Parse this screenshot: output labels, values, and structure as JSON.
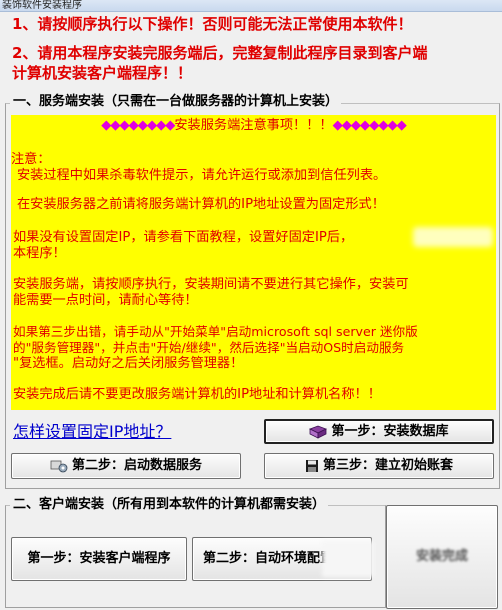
{
  "window": {
    "title": "装饰软件安装程序"
  },
  "warnings": {
    "line1": "1、请按顺序执行以下操作！否则可能无法正常使用本软件！",
    "line2a": "2、请用本程序安装完服务端后，完整复制此程序目录到客户端",
    "line2b": "计算机安装客户端程序！！"
  },
  "server_group": {
    "legend": "一、服务端安装（只需在一台做服务器的计算机上安装）",
    "notice": {
      "heading_diamonds_left": "◆◆◆◆◆◆◆◆",
      "heading_text": "安装服务端注意事项！！！",
      "heading_diamonds_right": "◆◆◆◆◆◆◆◆",
      "label": "注意：",
      "p1": "安装过程中如果杀毒软件提示，请允许运行或添加到信任列表。",
      "p2": "在安装服务器之前请将服务端计算机的IP地址设置为固定形式！",
      "p3a": "如果没有设置固定IP，请参看下面教程，设置好固定IP后，",
      "p3b": "本程序！",
      "p4a": "安装服务端，请按顺序执行，安装期间请不要进行其它操作，安装可",
      "p4b": "能需要一点时间，请耐心等待！",
      "p5a": "如果第三步出错，请手动从\"开始菜单\"启动microsoft sql server 迷你版",
      "p5b": "的\"服务管理器\"，并点击\"开始/继续\"，然后选择\"当启动OS时启动服务",
      "p5c": "\"复选框。启动好之后关闭服务管理器！",
      "p6": "安装完成后请不要更改服务端计算机的IP地址和计算机名称！！"
    },
    "help_link": "怎样设置固定IP地址？",
    "step1_label": "第一步：安装数据库",
    "step2_label": "第二步：启动数据服务",
    "step3_label": "第三步：建立初始账套"
  },
  "client_group": {
    "legend": "二、客户端安装（所有用到本软件的计算机都需安装）",
    "step1_label": "第一步：安装客户端程序",
    "step2_label": "第二步：自动环境配置",
    "step3_label": "安装完成"
  },
  "colors": {
    "warning_red": "#e00000",
    "notice_bg": "#ffff00",
    "diamond_magenta": "#e000e0",
    "link_blue": "#0000cc"
  }
}
